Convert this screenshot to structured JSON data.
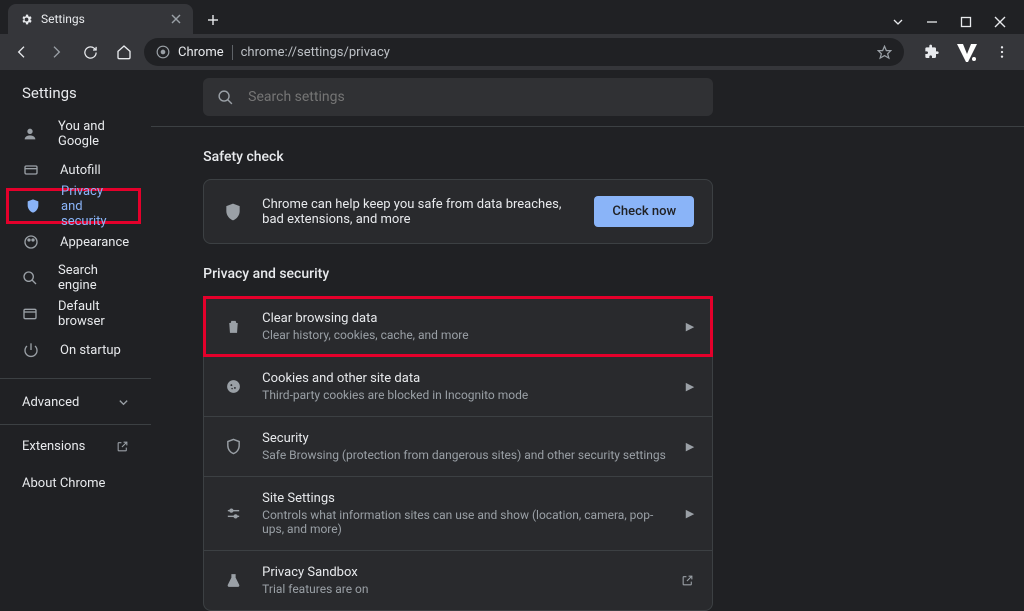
{
  "tab": {
    "title": "Settings"
  },
  "omnibox": {
    "prefix": "Chrome",
    "url": "chrome://settings/privacy"
  },
  "sidebar": {
    "title": "Settings",
    "items": [
      {
        "label": "You and Google"
      },
      {
        "label": "Autofill"
      },
      {
        "label": "Privacy and security"
      },
      {
        "label": "Appearance"
      },
      {
        "label": "Search engine"
      },
      {
        "label": "Default browser"
      },
      {
        "label": "On startup"
      }
    ],
    "advanced": "Advanced",
    "extensions": "Extensions",
    "about": "About Chrome"
  },
  "search": {
    "placeholder": "Search settings"
  },
  "safety": {
    "heading": "Safety check",
    "text": "Chrome can help keep you safe from data breaches, bad extensions, and more",
    "button": "Check now"
  },
  "privacy": {
    "heading": "Privacy and security",
    "rows": [
      {
        "title": "Clear browsing data",
        "sub": "Clear history, cookies, cache, and more"
      },
      {
        "title": "Cookies and other site data",
        "sub": "Third-party cookies are blocked in Incognito mode"
      },
      {
        "title": "Security",
        "sub": "Safe Browsing (protection from dangerous sites) and other security settings"
      },
      {
        "title": "Site Settings",
        "sub": "Controls what information sites can use and show (location, camera, pop-ups, and more)"
      },
      {
        "title": "Privacy Sandbox",
        "sub": "Trial features are on"
      }
    ]
  },
  "colors": {
    "accent": "#8ab4f8",
    "highlight": "#e4002b"
  }
}
